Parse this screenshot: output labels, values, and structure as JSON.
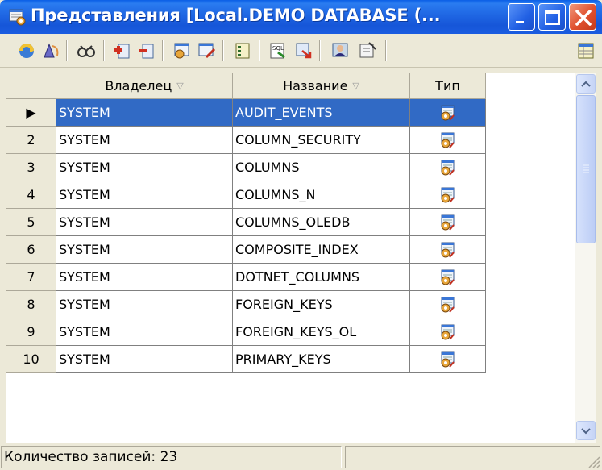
{
  "window": {
    "title": "Представления [Local.DEMO DATABASE (..."
  },
  "toolbar": {
    "buttons": [
      "refresh-icon",
      "bell-icon",
      "find-icon",
      "add-icon",
      "remove-icon",
      "view-icon",
      "view-edit-icon",
      "columns-icon",
      "sql-icon",
      "export-icon",
      "user-icon",
      "properties-icon",
      "grid-icon"
    ]
  },
  "grid": {
    "columns": [
      {
        "label": "Владелец",
        "sort": "▽"
      },
      {
        "label": "Название",
        "sort": "▽"
      },
      {
        "label": "Тип",
        "sort": ""
      }
    ],
    "rows": [
      {
        "num": "▶",
        "owner": "SYSTEM",
        "name": "AUDIT_EVENTS",
        "type": "view-icon",
        "selected": true
      },
      {
        "num": "2",
        "owner": "SYSTEM",
        "name": "COLUMN_SECURITY",
        "type": "view-icon"
      },
      {
        "num": "3",
        "owner": "SYSTEM",
        "name": "COLUMNS",
        "type": "view-icon"
      },
      {
        "num": "4",
        "owner": "SYSTEM",
        "name": "COLUMNS_N",
        "type": "view-icon"
      },
      {
        "num": "5",
        "owner": "SYSTEM",
        "name": "COLUMNS_OLEDB",
        "type": "view-icon"
      },
      {
        "num": "6",
        "owner": "SYSTEM",
        "name": "COMPOSITE_INDEX",
        "type": "view-icon"
      },
      {
        "num": "7",
        "owner": "SYSTEM",
        "name": "DOTNET_COLUMNS",
        "type": "view-icon"
      },
      {
        "num": "8",
        "owner": "SYSTEM",
        "name": "FOREIGN_KEYS",
        "type": "view-icon"
      },
      {
        "num": "9",
        "owner": "SYSTEM",
        "name": "FOREIGN_KEYS_OL",
        "type": "view-icon"
      },
      {
        "num": "10",
        "owner": "SYSTEM",
        "name": "PRIMARY_KEYS",
        "type": "view-icon"
      }
    ]
  },
  "status": {
    "records": "Количество записей: 23"
  },
  "colors": {
    "title_bar": "#1F66E3",
    "selection": "#316AC5",
    "chrome": "#ECE9D8"
  }
}
